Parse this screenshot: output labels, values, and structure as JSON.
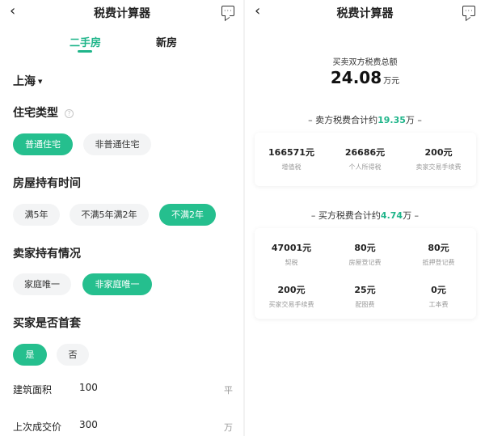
{
  "left": {
    "nav": {
      "back_icon": "‹",
      "title": "税费计算器",
      "message_icon": "message-icon"
    },
    "tabs": [
      {
        "label": "二手房",
        "active": true
      },
      {
        "label": "新房",
        "active": false
      }
    ],
    "city": {
      "label": "上海",
      "caret": "▼"
    },
    "sections": {
      "house_type": {
        "title": "住宅类型",
        "help_icon": "?",
        "options": [
          "普通住宅",
          "非普通住宅"
        ],
        "selected": "普通住宅"
      },
      "holding_time": {
        "title": "房屋持有时间",
        "options": [
          "满5年",
          "不满5年满2年",
          "不满2年"
        ],
        "selected": "不满2年"
      },
      "seller_status": {
        "title": "卖家持有情况",
        "options": [
          "家庭唯一",
          "非家庭唯一"
        ],
        "selected": "非家庭唯一"
      },
      "buyer_first": {
        "title": "买家是否首套",
        "options": [
          "是",
          "否"
        ],
        "selected": "是"
      }
    },
    "fields": {
      "area": {
        "label": "建筑面积",
        "value": "100",
        "unit": "平"
      },
      "last_price": {
        "label": "上次成交价",
        "value": "300",
        "unit": "万"
      }
    }
  },
  "right": {
    "nav": {
      "back_icon": "‹",
      "title": "税费计算器",
      "message_icon": "message-icon"
    },
    "total_label": "买卖双方税费总额",
    "total_value": "24.08",
    "total_unit": "万元",
    "seller": {
      "prefix": "– 卖方税费合计约",
      "amount": "19.35",
      "suffix": "万 –",
      "items": [
        {
          "value": "166571元",
          "label": "增值税"
        },
        {
          "value": "26686元",
          "label": "个人所得税"
        },
        {
          "value": "200元",
          "label": "卖家交易手续费"
        }
      ]
    },
    "buyer": {
      "prefix": "– 买方税费合计约",
      "amount": "4.74",
      "suffix": "万 –",
      "items": [
        {
          "value": "47001元",
          "label": "契税"
        },
        {
          "value": "80元",
          "label": "房屋登记费"
        },
        {
          "value": "80元",
          "label": "抵押登记费"
        },
        {
          "value": "200元",
          "label": "买家交易手续费"
        },
        {
          "value": "25元",
          "label": "配图费"
        },
        {
          "value": "0元",
          "label": "工本费"
        }
      ]
    }
  },
  "colors": {
    "accent": "#25bf8e",
    "accent_text": "#1fb58a",
    "chip_bg": "#f3f4f5"
  }
}
